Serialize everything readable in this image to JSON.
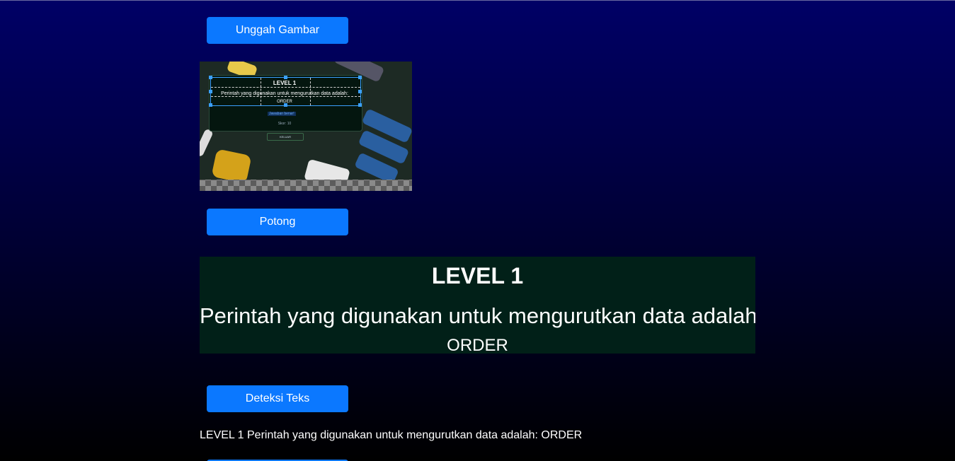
{
  "buttons": {
    "upload": "Unggah Gambar",
    "crop": "Potong",
    "detect": "Deteksi Teks",
    "next": ""
  },
  "preview": {
    "title": "LEVEL 1",
    "question": "Perintah yang digunakan untuk mengurutkan data adalah:",
    "answer": "ORDER",
    "correct_label": "Jawaban benar!",
    "score": "Skor: 10",
    "exit_label": "KELUAR"
  },
  "cropped": {
    "title": "LEVEL 1",
    "question": "Perintah yang digunakan untuk mengurutkan data adalah:",
    "answer": "ORDER"
  },
  "detected_text": "LEVEL 1 Perintah yang digunakan untuk mengurutkan data adalah: ORDER",
  "colors": {
    "button": "#0b78ff",
    "crop_handle": "#3aa0ff",
    "result_background": "#012018"
  }
}
